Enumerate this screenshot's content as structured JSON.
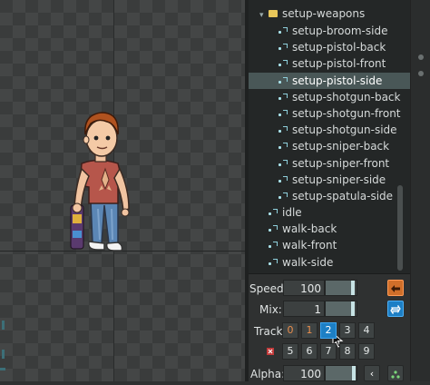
{
  "tree": {
    "folder": {
      "label": "setup-weapons"
    },
    "setup_items": [
      {
        "label": "setup-broom-side",
        "selected": false
      },
      {
        "label": "setup-pistol-back",
        "selected": false
      },
      {
        "label": "setup-pistol-front",
        "selected": false
      },
      {
        "label": "setup-pistol-side",
        "selected": true
      },
      {
        "label": "setup-shotgun-back",
        "selected": false
      },
      {
        "label": "setup-shotgun-front",
        "selected": false
      },
      {
        "label": "setup-shotgun-side",
        "selected": false
      },
      {
        "label": "setup-sniper-back",
        "selected": false
      },
      {
        "label": "setup-sniper-front",
        "selected": false
      },
      {
        "label": "setup-sniper-side",
        "selected": false
      },
      {
        "label": "setup-spatula-side",
        "selected": false
      }
    ],
    "root_items": [
      {
        "label": "idle"
      },
      {
        "label": "walk-back"
      },
      {
        "label": "walk-front"
      },
      {
        "label": "walk-side"
      }
    ]
  },
  "controls": {
    "speed": {
      "label": "Speed:",
      "value": "100",
      "fraction": 0.88
    },
    "mix": {
      "label": "Mix:",
      "value": "1",
      "fraction": 0.88
    },
    "track": {
      "label": "Track:",
      "row1": [
        "0",
        "1",
        "2",
        "3",
        "4"
      ],
      "row2": [
        "5",
        "6",
        "7",
        "8",
        "9"
      ],
      "active": "2",
      "warm": [
        "0",
        "1"
      ]
    },
    "alpha": {
      "label": "Alpha:",
      "value": "100",
      "fraction": 0.9
    }
  },
  "icons": {
    "speed_action": "back-arrow-icon",
    "mix_action": "loop-icon",
    "track_clear": "delete-track-icon",
    "alpha_prev": "chevron-left-icon",
    "alpha_add": "add-key-icon"
  },
  "colors": {
    "accent_active": "#1d7fc5",
    "orange_button": "#d06f2a",
    "selection": "#495757",
    "folder": "#e8c75a"
  }
}
